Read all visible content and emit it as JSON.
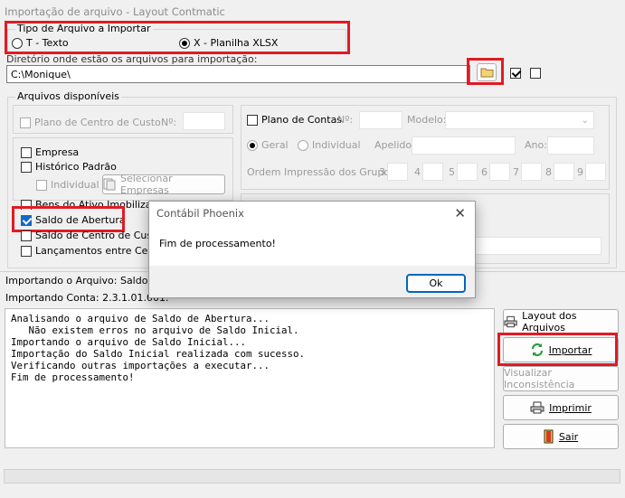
{
  "window": {
    "title": "Importação de arquivo - Layout Contmatic"
  },
  "tipo": {
    "label": "Tipo de Arquivo a Importar",
    "opt_t": "T - Texto",
    "opt_x": "X - Planilha XLSX"
  },
  "dir": {
    "label": "Diretório onde estão os arquivos para importação:",
    "value": "C:\\Monique\\"
  },
  "arquivos": {
    "label": "Arquivos disponíveis",
    "plano_cc": "Plano de Centro de Custo",
    "num": "Nº:",
    "empresa": "Empresa",
    "historico": "Histórico Padrão",
    "individual": "Individual",
    "selecionar": "Selecionar Empresas",
    "bens": "Bens do Ativo Imobilizado",
    "saldo": "Saldo de Abertura",
    "saldo_cc": "Saldo de Centro de Custo",
    "lanc": "Lançamentos entre Centros"
  },
  "plano_contas": {
    "label": "Plano de Contas",
    "num": "Nº:",
    "modelo": "Modelo:",
    "geral": "Geral",
    "individual": "Individual",
    "apelido": "Apelido:",
    "ano": "Ano:",
    "ordem": "Ordem Impressão dos Grupos:",
    "nums": [
      "3",
      "4",
      "5",
      "6",
      "7",
      "8",
      "9"
    ]
  },
  "status": {
    "arquivo": "Importando o Arquivo: Saldo Inicial",
    "conta": "Importando Conta: 2.3.1.01.001.0001"
  },
  "log_lines": [
    "Analisando o arquivo de Saldo de Abertura...",
    "   Não existem erros no arquivo de Saldo Inicial.",
    "Importando o arquivo de Saldo Inicial...",
    "Importação do Saldo Inicial realizada com sucesso.",
    "Verificando outras importações a executar...",
    "Fim de processamento!"
  ],
  "buttons": {
    "layout": "Layout dos Arquivos",
    "importar": "Importar",
    "visualizar": "Visualizar Inconsistência",
    "imprimir": "Imprimir",
    "sair": "Sair"
  },
  "dialog": {
    "title": "Contábil Phoenix",
    "message": "Fim de processamento!",
    "ok": "Ok"
  },
  "colors": {
    "highlight": "#e01b24",
    "accent": "#1467c8",
    "refresh": "#2e9b3c"
  }
}
